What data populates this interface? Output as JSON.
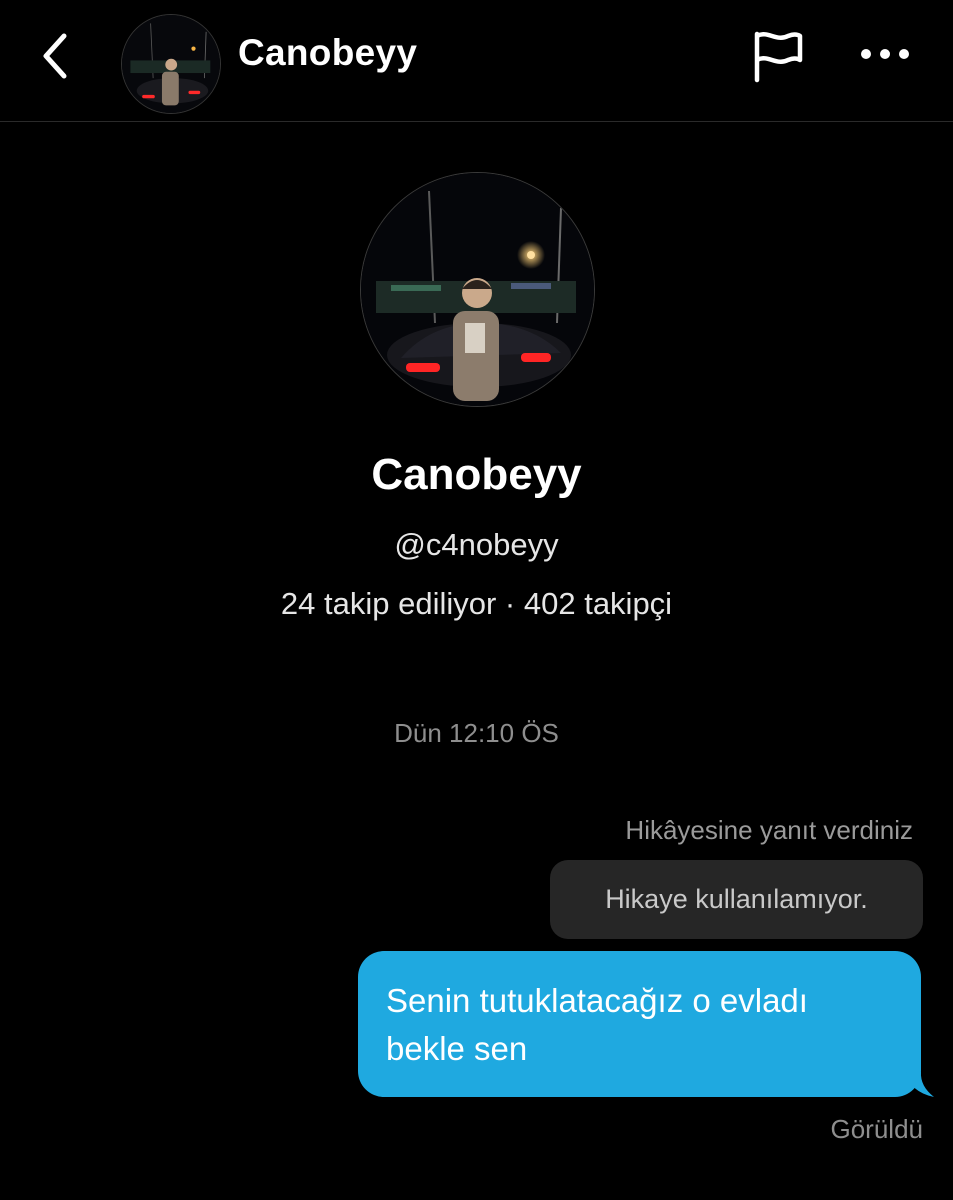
{
  "header": {
    "title": "Canobeyy",
    "back_icon": "chevron-left-icon",
    "flag_icon": "flag-icon",
    "more_icon": "more-horizontal-icon"
  },
  "profile": {
    "name": "Canobeyy",
    "handle": "@c4nobeyy",
    "stats": "24 takip ediliyor · 402 takipçi"
  },
  "chat": {
    "timestamp": "Dün 12:10 ÖS",
    "reply_note": "Hikâyesine yanıt verdiniz",
    "story_unavailable": "Hikaye kullanılamıyor.",
    "message_line1": "Senin tutuklatacağız o evladı",
    "message_line2": "bekle sen",
    "status": "Görüldü"
  },
  "colors": {
    "background": "#000000",
    "message_bubble": "#1fa9e0",
    "story_bubble": "#262626",
    "muted_text": "#8e8e8e"
  }
}
